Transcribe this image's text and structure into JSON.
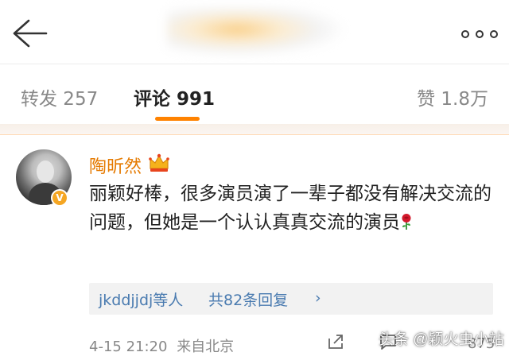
{
  "header": {
    "title": "",
    "back_icon": "back-arrow-icon",
    "more_icon": "more-icon"
  },
  "tabs": [
    {
      "label": "转发 257"
    },
    {
      "label": "评论 991",
      "active": true
    },
    {
      "label": "赞 1.8万"
    }
  ],
  "colors": {
    "accent": "#ff8200",
    "username": "#e57a00",
    "link": "#4a7bb0"
  },
  "comment": {
    "username": "陶昕然",
    "verified_badge": "V",
    "crown_icon": "crown-icon",
    "text": "丽颖好棒，很多演员演了一辈子都没有解决交流的问题，但她是一个认认真真交流的演员",
    "emoji": "rose-icon",
    "replies": {
      "users": "jkddjjdj等人",
      "count": "共82条回复",
      "chevron": "›"
    },
    "timestamp": "4-15 21:20",
    "location": "来自北京",
    "like_count": "875"
  },
  "watermark": "头条 @颖火虫小站"
}
